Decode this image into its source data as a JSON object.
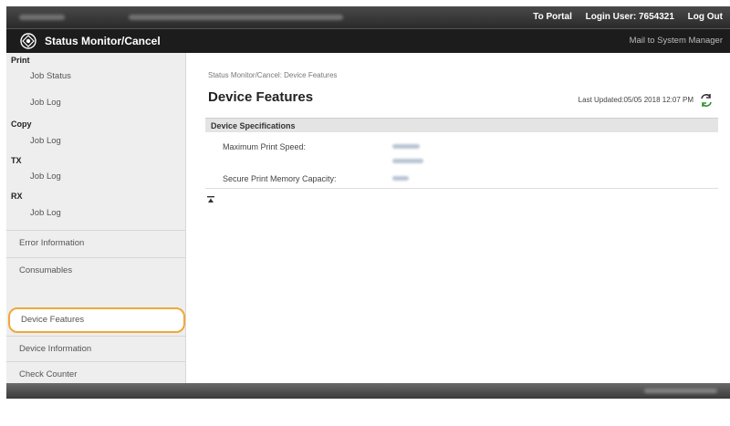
{
  "topbar": {
    "portal_link": "To Portal",
    "login_user": "Login User: 7654321",
    "logout_link": "Log Out"
  },
  "header": {
    "title": "Status Monitor/Cancel",
    "mail_link": "Mail to System Manager"
  },
  "sidebar": {
    "print_heading": "Print",
    "print_job_status": "Job Status",
    "print_job_log": "Job Log",
    "copy_heading": "Copy",
    "copy_job_log": "Job Log",
    "tx_heading": "TX",
    "tx_job_log": "Job Log",
    "rx_heading": "RX",
    "rx_job_log": "Job Log",
    "error_information": "Error Information",
    "consumables": "Consumables",
    "device_features": "Device Features",
    "device_information": "Device Information",
    "check_counter": "Check Counter"
  },
  "main": {
    "breadcrumb": "Status Monitor/Cancel: Device Features",
    "page_title": "Device Features",
    "last_updated": "Last Updated:05/05 2018 12:07 PM",
    "section_title": "Device Specifications",
    "specs": {
      "max_print_speed_label": "Maximum Print Speed:",
      "secure_print_memory_label": "Secure Print Memory Capacity:"
    }
  },
  "colors": {
    "selection_outline": "#f0a83a",
    "header_bg": "#1c1c1c",
    "sidebar_bg": "#eeeeee"
  },
  "icons": {
    "logo": "status-monitor-logo-icon",
    "refresh": "refresh-icon",
    "to_top": "back-to-top-icon"
  }
}
